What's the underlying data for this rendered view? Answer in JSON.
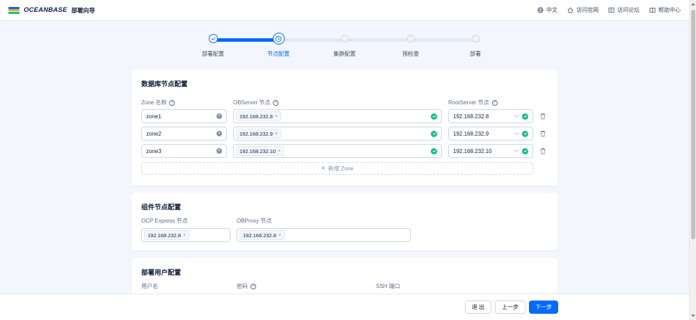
{
  "header": {
    "brand": "OCEANBASE",
    "app_title": "部署向导",
    "nav": [
      {
        "icon": "globe-icon",
        "label": "中文"
      },
      {
        "icon": "home-icon",
        "label": "访问官网"
      },
      {
        "icon": "forum-icon",
        "label": "访问论坛"
      },
      {
        "icon": "book-icon",
        "label": "帮助中心"
      }
    ]
  },
  "steps": {
    "current_index": 1,
    "items": [
      {
        "label": "部署配置",
        "status": "finish"
      },
      {
        "label": "节点配置",
        "status": "process"
      },
      {
        "label": "集群配置",
        "status": "wait"
      },
      {
        "label": "预检查",
        "status": "wait"
      },
      {
        "label": "部署",
        "status": "wait"
      }
    ]
  },
  "db_nodes": {
    "title": "数据库节点配置",
    "col_zone": "Zone 名称",
    "col_observer": "OBServer 节点",
    "col_rootserver": "RootServer 节点",
    "rows": [
      {
        "zone": "zone1",
        "observer": "192.168.232.8",
        "rootserver": "192.168.232.8"
      },
      {
        "zone": "zone2",
        "observer": "192.168.232.9",
        "rootserver": "192.168.232.9"
      },
      {
        "zone": "zone3",
        "observer": "192.168.232.10",
        "rootserver": "192.168.232.10"
      }
    ],
    "add_zone_label": "新增 Zone"
  },
  "component_nodes": {
    "title": "组件节点配置",
    "ocp_label": "OCP Express 节点",
    "ocp_value": "192.168.232.8",
    "obproxy_label": "OBProxy 节点",
    "obproxy_value": "192.168.232.8"
  },
  "user_config": {
    "title": "部署用户配置",
    "username_label": "用户名",
    "password_label": "密码",
    "ssh_port_label": "SSH 端口"
  },
  "footer": {
    "exit_label": "退 出",
    "prev_label": "上一步",
    "next_label": "下一步"
  },
  "colors": {
    "primary": "#006aff",
    "success": "#0ac185",
    "page_bg": "#f3f6fc"
  }
}
